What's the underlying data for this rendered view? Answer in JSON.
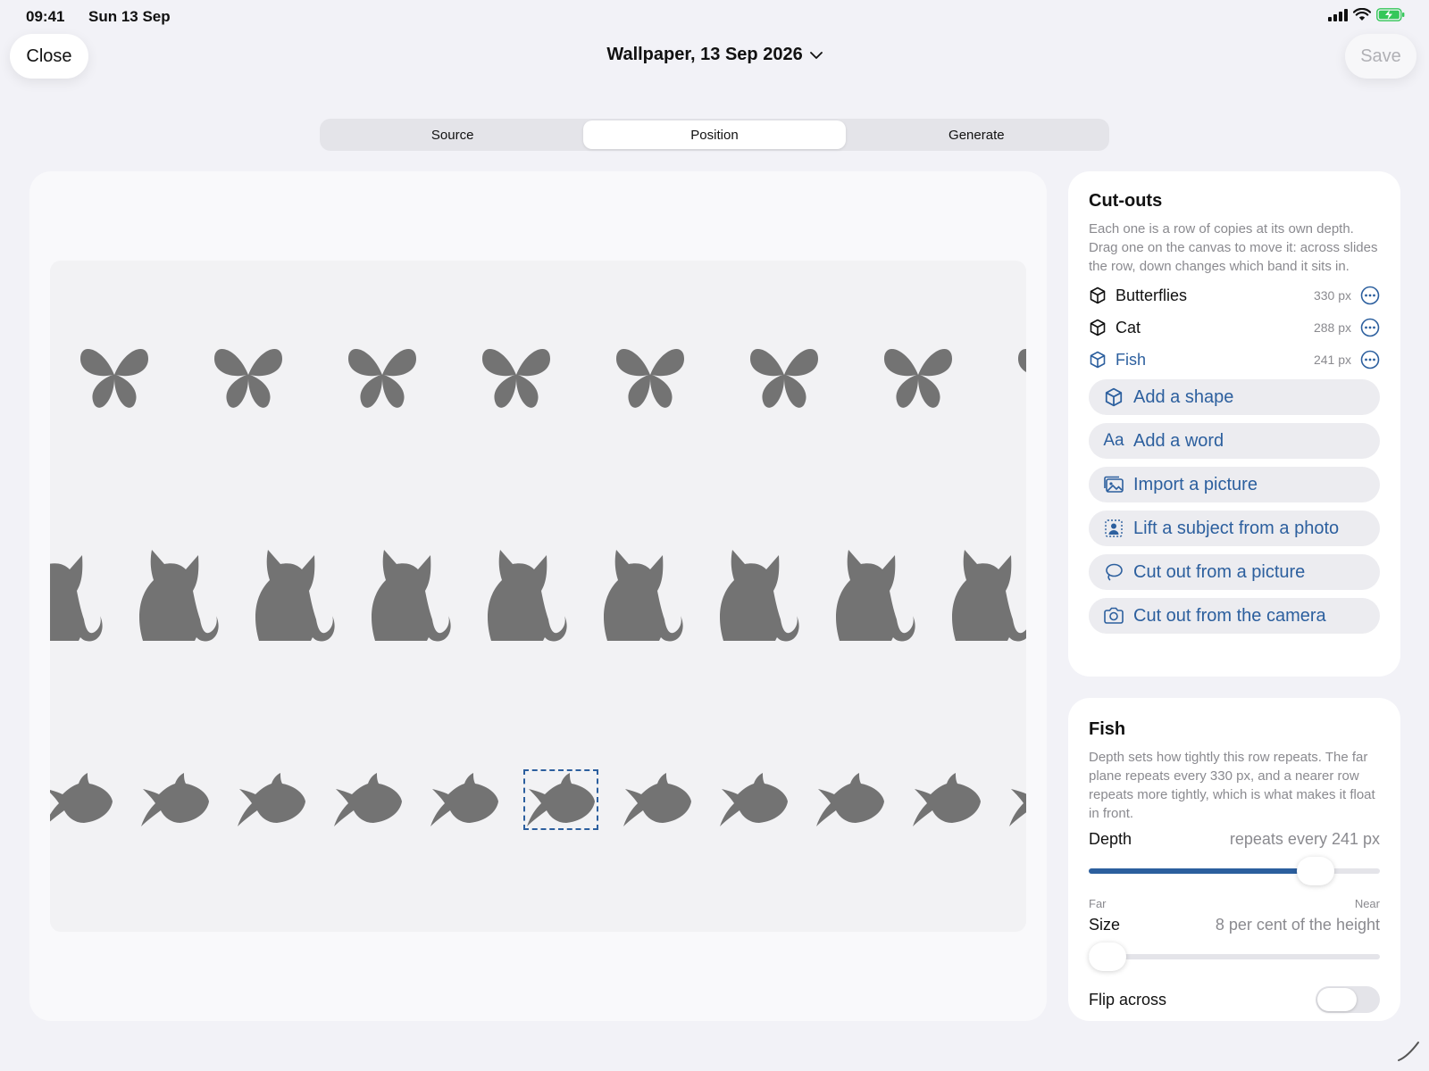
{
  "status": {
    "time": "09:41",
    "date": "Sun 13 Sep"
  },
  "header": {
    "close_label": "Close",
    "title": "Wallpaper, 13 Sep 2026",
    "save_label": "Save"
  },
  "tabs": [
    {
      "label": "Source",
      "active": false
    },
    {
      "label": "Position",
      "active": true
    },
    {
      "label": "Generate",
      "active": false
    }
  ],
  "canvas": {
    "rows": [
      {
        "shape": "butterfly",
        "color": "#737373"
      },
      {
        "shape": "cat",
        "color": "#737373"
      },
      {
        "shape": "fish",
        "color": "#737373",
        "selected_copy": 5
      }
    ],
    "accent": "#2c5f9e"
  },
  "cutouts": {
    "title": "Cut-outs",
    "description": "Each one is a row of copies at its own depth. Drag one on the canvas to move it: across slides the row, down changes which band it sits in.",
    "items": [
      {
        "name": "Butterflies",
        "repeat": "330 px",
        "icon": "cube-icon"
      },
      {
        "name": "Cat",
        "repeat": "288 px",
        "icon": "cube-icon"
      },
      {
        "name": "Fish",
        "repeat": "241 px",
        "icon": "cube-icon",
        "selected": true
      }
    ],
    "actions": [
      {
        "label": "Add a shape",
        "icon": "cube-icon"
      },
      {
        "label": "Add a word",
        "icon": "text-icon",
        "glyph": "Aa"
      },
      {
        "label": "Import a picture",
        "icon": "photo-stack-icon"
      },
      {
        "label": "Lift a subject from a photo",
        "icon": "person-lift-icon"
      },
      {
        "label": "Cut out from a picture",
        "icon": "lasso-icon"
      },
      {
        "label": "Cut out from the camera",
        "icon": "camera-icon"
      }
    ]
  },
  "selected_panel": {
    "title": "Fish",
    "description": "Depth sets how tightly this row repeats. The far plane repeats every 330 px, and a nearer row repeats more tightly, which is what makes it float in front.",
    "depth": {
      "label": "Depth",
      "value": "repeats every 241 px",
      "level": 0.78,
      "far": "Far",
      "near": "Near"
    },
    "size": {
      "label": "Size",
      "value": "8 per cent of the height",
      "level": 0.03
    },
    "flip": {
      "label": "Flip across",
      "on": false
    }
  }
}
